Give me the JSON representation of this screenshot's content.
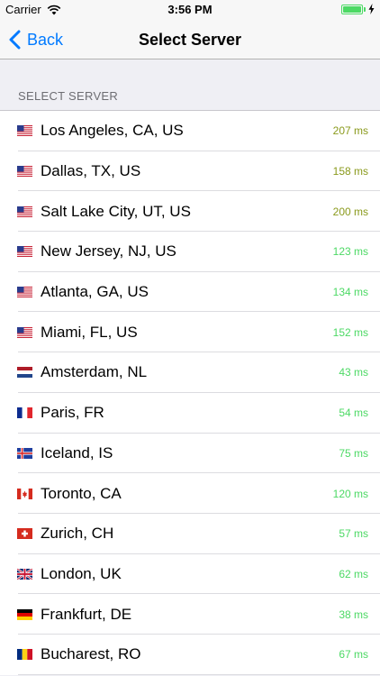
{
  "status_bar": {
    "carrier": "Carrier",
    "time": "3:56 PM",
    "battery_level": 1.0
  },
  "nav": {
    "back_label": "Back",
    "title": "Select Server"
  },
  "section_header": "SELECT SERVER",
  "colors": {
    "accent": "#007aff",
    "latency_slow": "#8a9a1c",
    "latency_fast": "#4cd964"
  },
  "servers": [
    {
      "name": "Los Angeles, CA, US",
      "latency": "207 ms",
      "flag": "us-flag-icon",
      "speed": "slow"
    },
    {
      "name": "Dallas, TX, US",
      "latency": "158 ms",
      "flag": "us-flag-icon",
      "speed": "slow"
    },
    {
      "name": "Salt Lake City, UT, US",
      "latency": "200 ms",
      "flag": "us-flag-icon",
      "speed": "slow"
    },
    {
      "name": "New Jersey, NJ, US",
      "latency": "123 ms",
      "flag": "us-flag-icon",
      "speed": "fast"
    },
    {
      "name": "Atlanta, GA, US",
      "latency": "134 ms",
      "flag": "us-flag-icon",
      "speed": "fast"
    },
    {
      "name": "Miami, FL, US",
      "latency": "152 ms",
      "flag": "us-flag-icon",
      "speed": "fast"
    },
    {
      "name": "Amsterdam, NL",
      "latency": "43 ms",
      "flag": "nl-flag-icon",
      "speed": "fast"
    },
    {
      "name": "Paris, FR",
      "latency": "54 ms",
      "flag": "fr-flag-icon",
      "speed": "fast"
    },
    {
      "name": "Iceland, IS",
      "latency": "75 ms",
      "flag": "is-flag-icon",
      "speed": "fast"
    },
    {
      "name": "Toronto, CA",
      "latency": "120 ms",
      "flag": "ca-flag-icon",
      "speed": "fast"
    },
    {
      "name": "Zurich, CH",
      "latency": "57 ms",
      "flag": "ch-flag-icon",
      "speed": "fast"
    },
    {
      "name": "London, UK",
      "latency": "62 ms",
      "flag": "uk-flag-icon",
      "speed": "fast"
    },
    {
      "name": "Frankfurt, DE",
      "latency": "38 ms",
      "flag": "de-flag-icon",
      "speed": "fast"
    },
    {
      "name": "Bucharest, RO",
      "latency": "67 ms",
      "flag": "ro-flag-icon",
      "speed": "fast"
    }
  ]
}
